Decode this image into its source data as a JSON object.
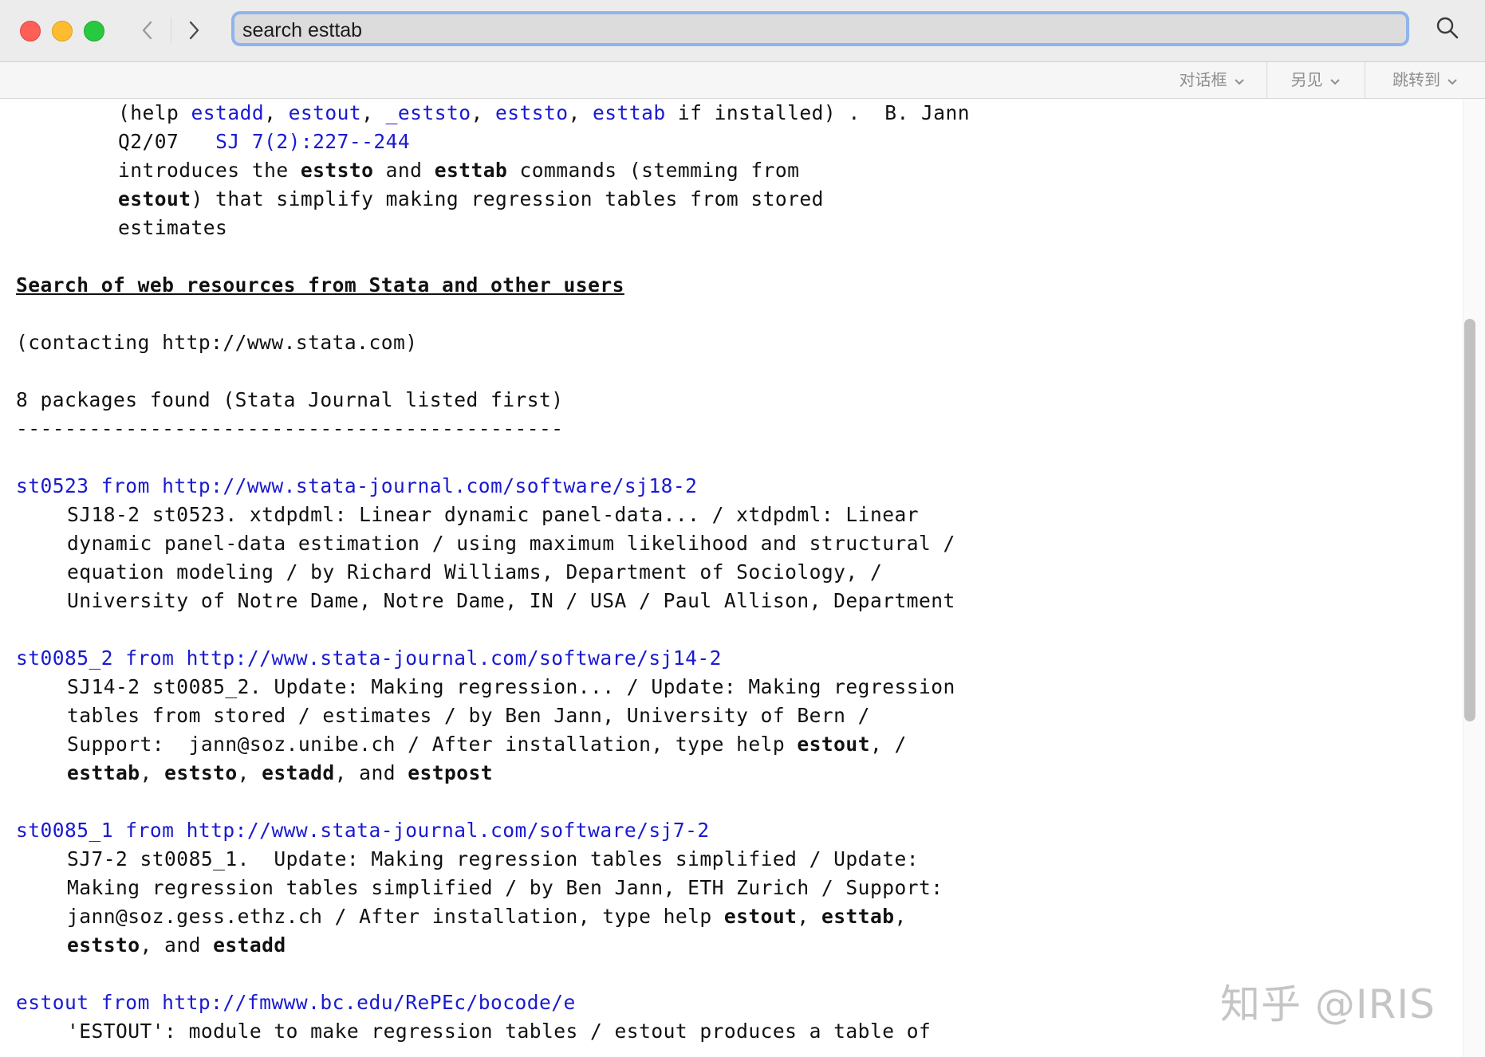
{
  "toolbar": {
    "search_value": "search esttab"
  },
  "subbar": {
    "dialog_label": "对话框",
    "seealso_label": "另见",
    "jumpto_label": "跳转到"
  },
  "intro": {
    "l1_a": "(help ",
    "l1_estadd": "estadd",
    "l1_c1": ", ",
    "l1_estout": "estout",
    "l1_c2": ", ",
    "l1_eststo_": "_eststo",
    "l1_c3": ", ",
    "l1_eststo": "eststo",
    "l1_c4": ", ",
    "l1_esttab": "esttab",
    "l1_tail": " if installed) .  B. Jann",
    "l2_date": "Q2/07   ",
    "l2_link": "SJ 7(2):227--244",
    "l3_a": "introduces the ",
    "l3_b1": "eststo",
    "l3_c": " and ",
    "l3_b2": "esttab",
    "l3_d": " commands (stemming from",
    "l4_b": "estout",
    "l4_rest": ") that simplify making regression tables from stored",
    "l5": "estimates"
  },
  "heading": "Search of web resources from Stata and other users",
  "contacting": "(contacting http://www.stata.com)",
  "found": "8 packages found (Stata Journal listed first)",
  "rule": "---------------------------------------------",
  "packages": [
    {
      "title": "st0523 from http://www.stata-journal.com/software/sj18-2",
      "l1": "SJ18-2 st0523. xtdpdml: Linear dynamic panel-data... / xtdpdml: Linear",
      "l2": "dynamic panel-data estimation / using maximum likelihood and structural /",
      "l3": "equation modeling / by Richard Williams, Department of Sociology, /",
      "l4": "University of Notre Dame, Notre Dame, IN / USA / Paul Allison, Department"
    },
    {
      "title": "st0085_2 from http://www.stata-journal.com/software/sj14-2",
      "l1": "SJ14-2 st0085_2. Update: Making regression... / Update: Making regression",
      "l2": "tables from stored / estimates / by Ben Jann, University of Bern /",
      "l3_a": "Support:  jann@soz.unibe.ch / After installation, type help ",
      "l3_b": "estout",
      "l3_c": ", /",
      "l4_b1": "esttab",
      "l4_c1": ", ",
      "l4_b2": "eststo",
      "l4_c2": ", ",
      "l4_b3": "estadd",
      "l4_c3": ", and ",
      "l4_b4": "estpost"
    },
    {
      "title": "st0085_1 from http://www.stata-journal.com/software/sj7-2",
      "l1": "SJ7-2 st0085_1.  Update: Making regression tables simplified / Update:",
      "l2": "Making regression tables simplified / by Ben Jann, ETH Zurich / Support:",
      "l3_a": "jann@soz.gess.ethz.ch / After installation, type help ",
      "l3_b1": "estout",
      "l3_c": ", ",
      "l3_b2": "esttab",
      "l3_d": ",",
      "l4_b1": "eststo",
      "l4_c": ", and ",
      "l4_b2": "estadd"
    },
    {
      "title": "estout from http://fmwww.bc.edu/RePEc/bocode/e",
      "l1": "'ESTOUT': module to make regression tables / estout produces a table of"
    }
  ],
  "watermark": "知乎 @IRIS"
}
